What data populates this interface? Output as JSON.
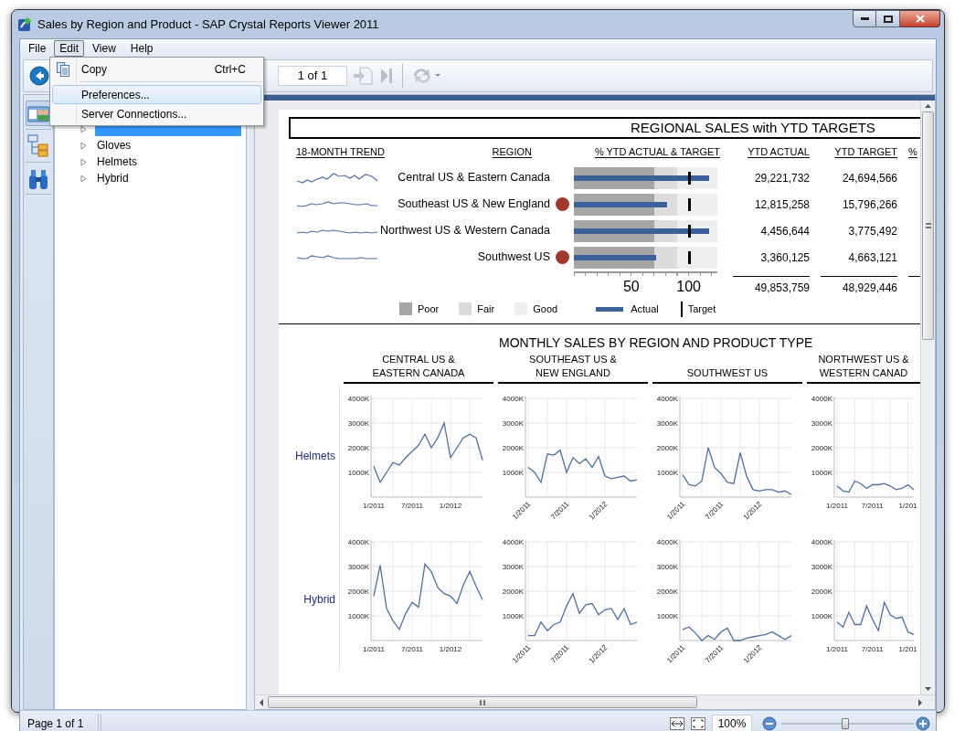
{
  "window": {
    "title": "Sales by Region and Product - SAP Crystal Reports Viewer 2011"
  },
  "menu_bar": [
    {
      "label": "File",
      "selected": false
    },
    {
      "label": "Edit",
      "selected": true
    },
    {
      "label": "View",
      "selected": false
    },
    {
      "label": "Help",
      "selected": false
    }
  ],
  "edit_menu": [
    {
      "kind": "item",
      "label": "Copy",
      "shortcut": "Ctrl+C",
      "highlighted": false
    },
    {
      "kind": "separator"
    },
    {
      "kind": "item",
      "label": "Preferences...",
      "highlighted": true
    },
    {
      "kind": "item",
      "label": "Server Connections...",
      "highlighted": false
    }
  ],
  "toolbar": {
    "page_field": "1 of 1"
  },
  "group_tree": [
    {
      "selected": true
    },
    {
      "label": "Gloves",
      "selected": false
    },
    {
      "label": "Helmets",
      "selected": false
    },
    {
      "label": "Hybrid",
      "selected": false
    }
  ],
  "report": {
    "title": "REGIONAL SALES with YTD TARGETS",
    "columns": [
      "18-MONTH TREND",
      "REGION",
      "% YTD ACTUAL & TARGET",
      "YTD ACTUAL",
      "YTD TARGET",
      "%"
    ],
    "rows": [
      {
        "region": "Central US & Eastern Canada",
        "alert": false,
        "actual": {
          "level": 0.944
        },
        "target": {
          "level": 0.8
        },
        "ytd_actual": "29,221,732",
        "ytd_target": "24,694,566"
      },
      {
        "region": "Southeast US & New England",
        "alert": true,
        "actual": {
          "level": 0.648
        },
        "target": {
          "level": 0.8
        },
        "ytd_actual": "12,815,258",
        "ytd_target": "15,796,266"
      },
      {
        "region": "Northwest US & Western Canada",
        "alert": false,
        "actual": {
          "level": 0.944
        },
        "target": {
          "level": 0.8
        },
        "ytd_actual": "4,456,644",
        "ytd_target": "3,775,492"
      },
      {
        "region": "Southwest US",
        "alert": true,
        "actual": {
          "level": 0.576
        },
        "target": {
          "level": 0.8
        },
        "ytd_actual": "3,360,125",
        "ytd_target": "4,663,121"
      }
    ],
    "bullet_axis": [
      "50",
      "100"
    ],
    "totals": {
      "ytd_actual": "49,853,759",
      "ytd_target": "48,929,446"
    },
    "legend": [
      {
        "label": "Poor",
        "kind": "band",
        "color": "#a6a6a6"
      },
      {
        "label": "Fair",
        "kind": "band",
        "color": "#dcdcdc"
      },
      {
        "label": "Good",
        "kind": "band",
        "color": "#eeeeee"
      },
      {
        "label": "Actual",
        "kind": "bar",
        "color": "#3c6199"
      },
      {
        "label": "Target",
        "kind": "marker",
        "color": "#000000"
      }
    ],
    "monthly": {
      "title": "MONTHLY SALES BY REGION AND PRODUCT TYPE",
      "columns": [
        "CENTRAL US &\nEASTERN CANADA",
        "SOUTHEAST US &\nNEW ENGLAND",
        "SOUTHWEST US",
        "NORTHWEST US &\nWESTERN CANAD"
      ],
      "rows": [
        {
          "label": "Helmets",
          "charts": [
            {
              "chart_data": {
                "type": "line",
                "grid": true,
                "categories": [
                  "1/2011",
                  null,
                  null,
                  null,
                  null,
                  null,
                  "7/2011",
                  null,
                  null,
                  null,
                  null,
                  null,
                  "1/2012",
                  null,
                  null,
                  null,
                  null,
                  null
                ],
                "ylim": [
                  0,
                  4000
                ],
                "yticks": [
                  {
                    "value": 1000,
                    "label": "1000K"
                  },
                  {
                    "value": 2000,
                    "label": "2000K"
                  },
                  {
                    "value": 3000,
                    "label": "3000K"
                  },
                  {
                    "value": 4000,
                    "label": "4000K"
                  }
                ],
                "series": [
                  {
                    "color": "#4e6fa3",
                    "values": [
                      1250,
                      600,
                      1000,
                      1400,
                      1300,
                      1600,
                      1850,
                      2100,
                      2550,
                      2000,
                      2400,
                      3000,
                      1600,
                      2000,
                      2400,
                      2550,
                      2400,
                      1500
                    ]
                  }
                ]
              }
            },
            {
              "chart_data": {
                "type": "line",
                "grid": true,
                "categories": [
                  "1/2011",
                  null,
                  null,
                  null,
                  null,
                  null,
                  "7/2011",
                  null,
                  null,
                  null,
                  null,
                  null,
                  "1/2012",
                  null,
                  null,
                  null,
                  null,
                  null
                ],
                "ylim": [
                  0,
                  4000
                ],
                "yticks": [
                  {
                    "value": 1000,
                    "label": "1000K"
                  },
                  {
                    "value": 2000,
                    "label": "2000K"
                  },
                  {
                    "value": 3000,
                    "label": "3000K"
                  },
                  {
                    "value": 4000,
                    "label": "4000K"
                  }
                ],
                "series": [
                  {
                    "color": "#4e6fa3",
                    "values": [
                      1200,
                      1000,
                      600,
                      1750,
                      1700,
                      1900,
                      1000,
                      1600,
                      1350,
                      1550,
                      1200,
                      1650,
                      850,
                      750,
                      800,
                      850,
                      650,
                      700
                    ]
                  }
                ]
              }
            },
            {
              "chart_data": {
                "type": "line",
                "grid": true,
                "categories": [
                  "1/2011",
                  null,
                  null,
                  null,
                  null,
                  null,
                  "7/2011",
                  null,
                  null,
                  null,
                  null,
                  null,
                  "1/2012",
                  null,
                  null,
                  null,
                  null,
                  null
                ],
                "ylim": [
                  0,
                  4000
                ],
                "yticks": [
                  {
                    "value": 1000,
                    "label": "1000K"
                  },
                  {
                    "value": 2000,
                    "label": "2000K"
                  },
                  {
                    "value": 3000,
                    "label": "3000K"
                  },
                  {
                    "value": 4000,
                    "label": "4000K"
                  }
                ],
                "series": [
                  {
                    "color": "#4e6fa3",
                    "values": [
                      900,
                      500,
                      450,
                      650,
                      2000,
                      1200,
                      950,
                      600,
                      550,
                      1800,
                      850,
                      300,
                      250,
                      300,
                      300,
                      200,
                      250,
                      100
                    ]
                  }
                ]
              }
            },
            {
              "chart_data": {
                "type": "line",
                "grid": true,
                "categories": [
                  "1/2011",
                  null,
                  null,
                  null,
                  null,
                  null,
                  "7/2011",
                  null,
                  null,
                  null,
                  null,
                  null,
                  "1/201",
                  null
                ],
                "ylim": [
                  0,
                  4000
                ],
                "yticks": [
                  {
                    "value": 1000,
                    "label": "1000K"
                  },
                  {
                    "value": 2000,
                    "label": "2000K"
                  },
                  {
                    "value": 3000,
                    "label": "3000K"
                  },
                  {
                    "value": 4000,
                    "label": "4000K"
                  }
                ],
                "series": [
                  {
                    "color": "#4e6fa3",
                    "values": [
                      450,
                      250,
                      200,
                      650,
                      550,
                      350,
                      500,
                      500,
                      550,
                      450,
                      300,
                      350,
                      500,
                      300
                    ]
                  }
                ]
              }
            }
          ]
        },
        {
          "label": "Hybrid",
          "charts": [
            {
              "chart_data": {
                "type": "line",
                "grid": true,
                "categories": [
                  "1/2011",
                  null,
                  null,
                  null,
                  null,
                  null,
                  "7/2011",
                  null,
                  null,
                  null,
                  null,
                  null,
                  "1/2012",
                  null,
                  null,
                  null,
                  null,
                  null
                ],
                "ylim": [
                  0,
                  4000
                ],
                "yticks": [
                  {
                    "value": 1000,
                    "label": "1000K"
                  },
                  {
                    "value": 2000,
                    "label": "2000K"
                  },
                  {
                    "value": 3000,
                    "label": "3000K"
                  },
                  {
                    "value": 4000,
                    "label": "4000K"
                  }
                ],
                "series": [
                  {
                    "color": "#4e6fa3",
                    "values": [
                      1800,
                      3050,
                      1300,
                      800,
                      450,
                      1100,
                      1550,
                      1350,
                      3100,
                      2800,
                      2150,
                      1900,
                      1800,
                      1500,
                      2250,
                      2800,
                      2200,
                      1650
                    ]
                  }
                ]
              }
            },
            {
              "chart_data": {
                "type": "line",
                "grid": true,
                "categories": [
                  "1/2011",
                  null,
                  null,
                  null,
                  null,
                  null,
                  "7/2011",
                  null,
                  null,
                  null,
                  null,
                  null,
                  "1/2012",
                  null,
                  null,
                  null,
                  null,
                  null
                ],
                "ylim": [
                  0,
                  4000
                ],
                "yticks": [
                  {
                    "value": 1000,
                    "label": "1000K"
                  },
                  {
                    "value": 2000,
                    "label": "2000K"
                  },
                  {
                    "value": 3000,
                    "label": "3000K"
                  },
                  {
                    "value": 4000,
                    "label": "4000K"
                  }
                ],
                "series": [
                  {
                    "color": "#4e6fa3",
                    "values": [
                      200,
                      200,
                      750,
                      400,
                      650,
                      750,
                      1400,
                      1900,
                      1100,
                      1450,
                      1500,
                      1050,
                      1250,
                      1300,
                      850,
                      1300,
                      650,
                      750
                    ]
                  }
                ]
              }
            },
            {
              "chart_data": {
                "type": "line",
                "grid": true,
                "categories": [
                  "1/2011",
                  null,
                  null,
                  null,
                  null,
                  null,
                  "7/2011",
                  null,
                  null,
                  null,
                  null,
                  null,
                  "1/2012",
                  null,
                  null,
                  null,
                  null,
                  null
                ],
                "ylim": [
                  0,
                  4000
                ],
                "yticks": [
                  {
                    "value": 1000,
                    "label": "1000K"
                  },
                  {
                    "value": 2000,
                    "label": "2000K"
                  },
                  {
                    "value": 3000,
                    "label": "3000K"
                  },
                  {
                    "value": 4000,
                    "label": "4000K"
                  }
                ],
                "series": [
                  {
                    "color": "#4e6fa3",
                    "values": [
                      450,
                      550,
                      300,
                      0,
                      200,
                      50,
                      350,
                      500,
                      0,
                      0,
                      100,
                      150,
                      200,
                      250,
                      350,
                      200,
                      50,
                      200
                    ]
                  }
                ]
              }
            },
            {
              "chart_data": {
                "type": "line",
                "grid": true,
                "categories": [
                  "1/2011",
                  null,
                  null,
                  null,
                  null,
                  null,
                  "7/2011",
                  null,
                  null,
                  null,
                  null,
                  null,
                  "1/201",
                  null
                ],
                "ylim": [
                  0,
                  4000
                ],
                "yticks": [
                  {
                    "value": 1000,
                    "label": "1000K"
                  },
                  {
                    "value": 2000,
                    "label": "2000K"
                  },
                  {
                    "value": 3000,
                    "label": "3000K"
                  },
                  {
                    "value": 4000,
                    "label": "4000K"
                  }
                ],
                "series": [
                  {
                    "color": "#4e6fa3",
                    "values": [
                      750,
                      550,
                      1150,
                      650,
                      650,
                      1400,
                      850,
                      400,
                      1550,
                      1050,
                      900,
                      950,
                      350,
                      250
                    ]
                  }
                ]
              }
            }
          ]
        }
      ]
    }
  },
  "status_bar": {
    "page": "Page 1 of 1",
    "zoom": "100%",
    "zoom_slider": {
      "level": 0.48
    }
  }
}
